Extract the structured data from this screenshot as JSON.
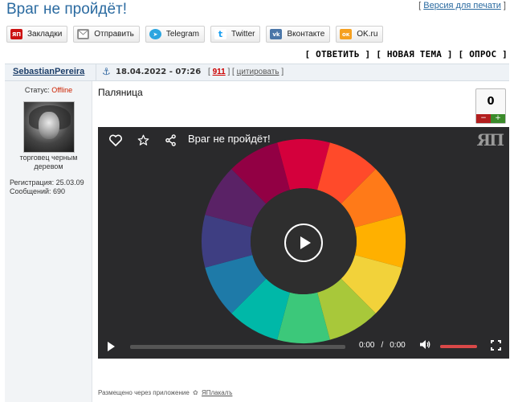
{
  "topic": {
    "title": "Враг не пройдёт!",
    "print_link": "Версия для печати"
  },
  "share_buttons": [
    {
      "label": "Закладки",
      "icon": "yap-icon",
      "icon_text": "ЯП"
    },
    {
      "label": "Отправить",
      "icon": "envelope-icon",
      "icon_text": "✉"
    },
    {
      "label": "Telegram",
      "icon": "telegram-icon",
      "icon_text": "➤"
    },
    {
      "label": "Twitter",
      "icon": "twitter-icon",
      "icon_text": "t"
    },
    {
      "label": "Вконтакте",
      "icon": "vk-icon",
      "icon_text": "vk"
    },
    {
      "label": "OK.ru",
      "icon": "ok-icon",
      "icon_text": "ок"
    }
  ],
  "actions": {
    "reply": "ОТВЕТИТЬ",
    "new_topic": "НОВАЯ ТЕМА",
    "poll": "ОПРОС"
  },
  "post": {
    "author": "SebastianPereira",
    "date": "18.04.2022 - 07:26",
    "number": "911",
    "quote": "цитировать",
    "text": "Паляница",
    "rating": "0",
    "footer_prefix": "Размещено через приложение",
    "footer_app": "ЯПлакалъ"
  },
  "user": {
    "status_label": "Статус:",
    "status_value": "Offline",
    "title_line1": "торговец черным",
    "title_line2": "деревом",
    "registration": "Регистрация: 25.03.09",
    "messages": "Сообщений: 690"
  },
  "video": {
    "title": "Враг не пройдёт!",
    "logo": "ЯП",
    "current_time": "0:00",
    "duration": "0:00",
    "progress": 0,
    "volume": 1.0,
    "colors": {
      "wheel_segments": [
        "#d4003c",
        "#ff4a2a",
        "#ff7a18",
        "#ffb000",
        "#f2d23a",
        "#a8c83a",
        "#3cc87a",
        "#00b8a8",
        "#1e7aa8",
        "#3e3e82",
        "#5a2266",
        "#920044"
      ],
      "volume_fill": "#d94848",
      "background": "#2a2a2c"
    }
  }
}
